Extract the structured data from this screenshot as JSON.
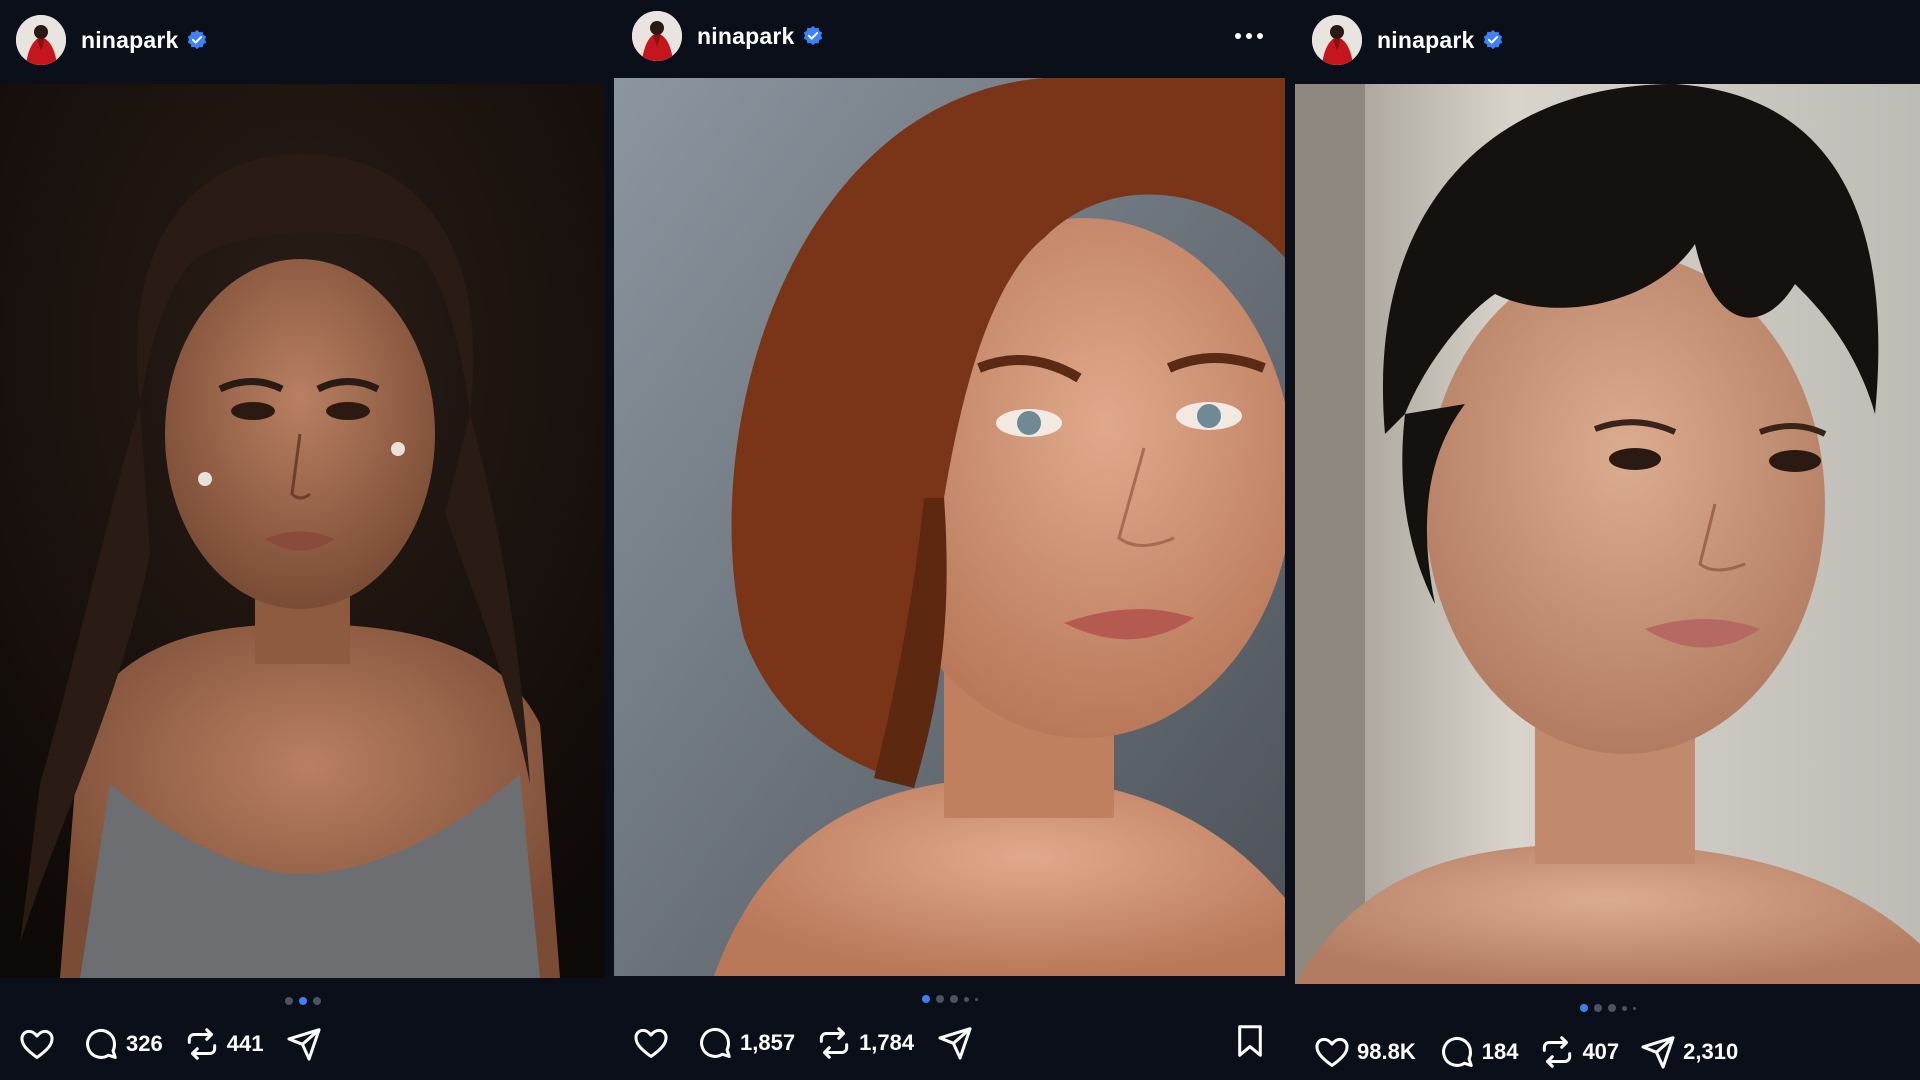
{
  "posts": [
    {
      "username": "ninapark",
      "verified": true,
      "carousel": {
        "count": 3,
        "active": 1
      },
      "likes": "",
      "comments": "326",
      "reposts": "441",
      "shares": "",
      "has_more_menu": false,
      "has_bookmark": false
    },
    {
      "username": "ninapark",
      "verified": true,
      "carousel": {
        "count": 5,
        "active": 0
      },
      "likes": "",
      "comments": "1,857",
      "reposts": "1,784",
      "shares": "",
      "has_more_menu": true,
      "has_bookmark": true
    },
    {
      "username": "ninapark",
      "verified": true,
      "carousel": {
        "count": 5,
        "active": 0
      },
      "likes": "98.8K",
      "comments": "184",
      "reposts": "407",
      "shares": "2,310",
      "has_more_menu": false,
      "has_bookmark": false
    }
  ],
  "icons": {
    "like": "heart-icon",
    "comment": "comment-icon",
    "repost": "repost-icon",
    "share": "send-icon",
    "verified": "verified-badge-icon",
    "more": "more-icon",
    "bookmark": "bookmark-icon"
  },
  "colors": {
    "background": "#0b0f19",
    "accent": "#3b82f6",
    "inactive_dot": "#4b5363"
  }
}
